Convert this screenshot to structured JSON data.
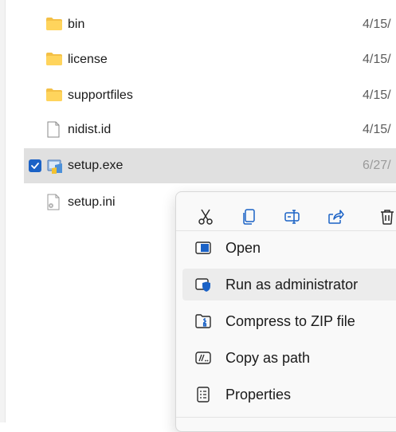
{
  "files": [
    {
      "name": "bin",
      "date": "4/15/"
    },
    {
      "name": "license",
      "date": "4/15/"
    },
    {
      "name": "supportfiles",
      "date": "4/15/"
    },
    {
      "name": "nidist.id",
      "date": "4/15/"
    },
    {
      "name": "setup.exe",
      "date": "6/27/"
    },
    {
      "name": "setup.ini",
      "date": ""
    }
  ],
  "context_menu": {
    "quick_actions": [
      {
        "icon": "cut-icon"
      },
      {
        "icon": "copy-icon"
      },
      {
        "icon": "rename-icon"
      },
      {
        "icon": "share-icon"
      },
      {
        "icon": "delete-icon"
      }
    ],
    "items": [
      {
        "label": "Open",
        "icon": "open-icon"
      },
      {
        "label": "Run as administrator",
        "icon": "shield-icon"
      },
      {
        "label": "Compress to ZIP file",
        "icon": "zip-icon"
      },
      {
        "label": "Copy as path",
        "icon": "path-icon"
      },
      {
        "label": "Properties",
        "icon": "properties-icon"
      }
    ]
  },
  "colors": {
    "folder": "#f4c046",
    "selection": "#e0e0e0",
    "accent": "#1b62c6"
  }
}
